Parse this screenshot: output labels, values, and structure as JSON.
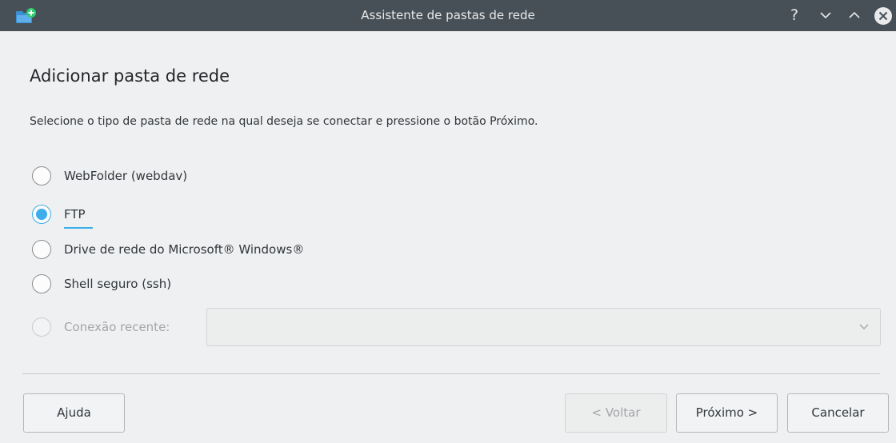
{
  "window": {
    "title": "Assistente de pastas de rede",
    "help_glyph": "?",
    "app_icon": "network-folder-add-icon"
  },
  "page": {
    "heading": "Adicionar pasta de rede",
    "description": "Selecione o tipo de pasta de rede na qual deseja se conectar e pressione o botão Próximo."
  },
  "options": [
    {
      "label": "WebFolder (webdav)",
      "checked": false,
      "enabled": true
    },
    {
      "label": "FTP",
      "checked": true,
      "enabled": true
    },
    {
      "label": "Drive de rede do Microsoft® Windows®",
      "checked": false,
      "enabled": true
    },
    {
      "label": "Shell seguro (ssh)",
      "checked": false,
      "enabled": true
    },
    {
      "label": "Conexão recente:",
      "checked": false,
      "enabled": false
    }
  ],
  "recent_combo": {
    "value": "",
    "enabled": false
  },
  "buttons": {
    "help": "Ajuda",
    "back": "< Voltar",
    "next": "Próximo >",
    "cancel": "Cancelar"
  },
  "colors": {
    "titlebar": "#475057",
    "accent": "#3daee9",
    "background": "#eff0f1"
  }
}
